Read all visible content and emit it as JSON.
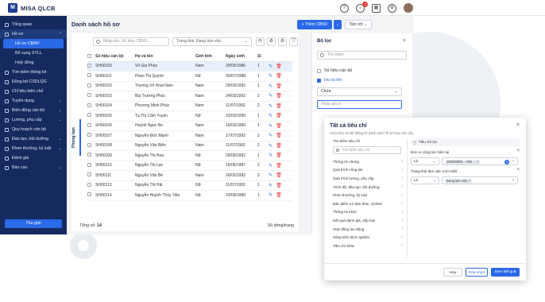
{
  "app": {
    "logo_mark": "M",
    "name": "MISA QLCB",
    "notification_count": "2"
  },
  "topbar_icons": [
    "help-icon",
    "bell-icon",
    "grid-icon",
    "settings-icon"
  ],
  "sidebar": {
    "items": [
      {
        "label": "Tổng quan",
        "chev": ""
      },
      {
        "label": "Hồ sơ",
        "chev": "⌃"
      },
      {
        "label": "Hồ sơ CBNV",
        "chev": "",
        "sub": true,
        "active": true
      },
      {
        "label": "Bổ sung SYLL",
        "chev": "",
        "sub": true
      },
      {
        "label": "Hợp đồng",
        "chev": "",
        "sub": true
      },
      {
        "label": "Tìm kiếm thông kê",
        "chev": ""
      },
      {
        "label": "Đồng bộ CSDLQG",
        "chev": ""
      },
      {
        "label": "Chỉ tiêu biên chế",
        "chev": ""
      },
      {
        "label": "Tuyển dụng",
        "chev": "⌄"
      },
      {
        "label": "Biến động cán bộ",
        "chev": "⌄"
      },
      {
        "label": "Lương, phụ cấp",
        "chev": "⌄"
      },
      {
        "label": "Quy hoạch cán bộ",
        "chev": ""
      },
      {
        "label": "Đào tạo, bồi dưỡng",
        "chev": "⌄"
      },
      {
        "label": "Khen thưởng, kỷ luật",
        "chev": "⌄"
      },
      {
        "label": "Đánh giá",
        "chev": ""
      },
      {
        "label": "Báo cáo",
        "chev": "⌄"
      }
    ],
    "collapse_label": "Thu gọn"
  },
  "main": {
    "title": "Danh sách hồ sơ",
    "add_button": "+ Thêm CBNV",
    "add_dropdown": "⌄",
    "utilities_button": "Tiện ích ⌄",
    "search_placeholder": "Nhập tên, Số hiệu CBNV...",
    "status_select": "Trạng thái: Đang làm việc",
    "tool_icons": [
      "⟳",
      "⚙",
      "⚙",
      "⛉"
    ],
    "department_tab": "Phòng ban",
    "columns": [
      "Số hiệu cán bộ",
      "Họ và tên",
      "Giới tính",
      "Ngày sinh",
      "Si"
    ],
    "rows": [
      {
        "code": "SH00100",
        "name": "Võ Gia Phúc",
        "gender": "Nam",
        "dob": "29/05/1986",
        "extra": "1",
        "hl": true
      },
      {
        "code": "SH00101",
        "name": "Phan Thị Quỳnh",
        "gender": "Nữ",
        "dob": "30/07/1988",
        "extra": "1"
      },
      {
        "code": "SH00102",
        "name": "Trương Võ Hoài Nam",
        "gender": "Nam",
        "dob": "29/03/1992",
        "extra": "1"
      },
      {
        "code": "SH00103",
        "name": "Bùi Trường Phúc",
        "gender": "Nam",
        "dob": "24/03/1992",
        "extra": "2"
      },
      {
        "code": "SH00104",
        "name": "Phương Minh Phúc",
        "gender": "Nam",
        "dob": "11/07/1992",
        "extra": "2"
      },
      {
        "code": "SH00105",
        "name": "Tạ Thị Cẩm Tuyền",
        "gender": "Nữ",
        "dob": "23/03/1999",
        "extra": "1"
      },
      {
        "code": "SH00106",
        "name": "Huỳnh Ngọc Bo",
        "gender": "Nam",
        "dob": "19/03/1989",
        "extra": "1"
      },
      {
        "code": "SH00107",
        "name": "Nguyễn Đức Mạnh",
        "gender": "Nam",
        "dob": "17/07/1992",
        "extra": "2"
      },
      {
        "code": "SH00108",
        "name": "Nguyễn Văn Biên",
        "gender": "Nam",
        "dob": "11/07/1992",
        "extra": "2"
      },
      {
        "code": "SH00109",
        "name": "Nguyễn Thị Hoa",
        "gender": "Nữ",
        "dob": "29/05/1992",
        "extra": "1"
      },
      {
        "code": "SH00110",
        "name": "Nguyễn Thị Lan",
        "gender": "Nữ",
        "dob": "16/06/1987",
        "extra": "2"
      },
      {
        "code": "SH00111",
        "name": "Nguyễn Văn Bê",
        "gender": "Nam",
        "dob": "26/02/1992",
        "extra": "2"
      },
      {
        "code": "SH00113",
        "name": "Nguyễn Thị Hải",
        "gender": "Nữ",
        "dob": "11/07/1992",
        "extra": "1"
      },
      {
        "code": "SH00114",
        "name": "Nguyễn Huỳnh Thủy Tiên",
        "gender": "Nữ",
        "dob": "23/09/1989",
        "extra": "1"
      }
    ],
    "total_label": "Tổng số: ",
    "total_value": "14",
    "page_size_label": "Số dòng/trang"
  },
  "filter_panel": {
    "title": "Bộ lọc",
    "search_placeholder": "Tìm kiếm",
    "options": [
      {
        "label": "Số hiệu cán bộ",
        "checked": false
      },
      {
        "label": "Họ và tên",
        "checked": true
      }
    ],
    "condition_select": "Chứa",
    "value_placeholder": "Nhập giá trị"
  },
  "modal": {
    "title": "Tất cả tiêu chí",
    "subtitle": "Chọn tiêu chí để thống kê danh sách hồ sơ theo nhu cầu",
    "left_label": "Tìm kiếm tiêu chí",
    "left_search_placeholder": "Tìm kiếm tiêu chí",
    "categories": [
      "Thông tin chung",
      "Quá trình công tác",
      "Quá trình lương, phụ cấp",
      "Trình độ, đào tạo, bồi dưỡng",
      "Khen thưởng, kỷ luật",
      "Đặc điểm LS bản thân, QHGĐ",
      "Thông tin khác",
      "Kết quả đánh giá, xếp loại",
      "Hợp đồng lao động",
      "Sáng kiến kinh nghiệm",
      "Tiêu chí khác"
    ],
    "right_header": "Tiêu chí lọc",
    "conditions": [
      {
        "label": "Đơn vị công tác hiện tại",
        "op": "Là",
        "chip": "100400001 - Văn ...",
        "count": "6"
      },
      {
        "label": "Trạng thái làm việc mới nhất",
        "op": "Là",
        "chip": "Đang làm việc",
        "count": ""
      }
    ],
    "cancel_button": "Hủy",
    "clear_button": "Xóa chọn",
    "apply_button": "Xem kết quả"
  }
}
